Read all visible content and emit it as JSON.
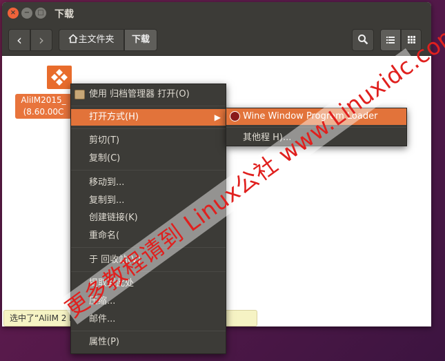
{
  "window": {
    "title": "下载",
    "controls": {
      "close": "×",
      "minimize": "−",
      "maximize": "□"
    }
  },
  "toolbar": {
    "back_icon": "‹",
    "forward_icon": "›",
    "breadcrumb": {
      "home_label": "主文件夹",
      "current_label": "下载"
    },
    "search_icon": "search-icon",
    "view_list_icon": "list-view-icon",
    "view_grid_icon": "grid-view-icon"
  },
  "files": [
    {
      "name_line1": "AliIM2015_",
      "name_line2": "(8.60.00C",
      "icon": "package-icon",
      "selected": true
    }
  ],
  "statusbar": {
    "text": "选中了“AliIM                                               2 MB)"
  },
  "context_menu": {
    "items": [
      {
        "label": "使用 归档管理器 打开(O)",
        "icon": "archive-manager-icon"
      },
      {
        "label": "打开方式(H)",
        "has_submenu": true,
        "active": true
      },
      {
        "label": "剪切(T)"
      },
      {
        "label": "复制(C)"
      },
      {
        "label": "移动到..."
      },
      {
        "label": "复制到..."
      },
      {
        "label": "创建链接(K)"
      },
      {
        "label": "重命名("
      },
      {
        "label": "于 回收站(V)"
      },
      {
        "label": "提取到此处"
      },
      {
        "label": "压缩..."
      },
      {
        "label": "邮件..."
      },
      {
        "label": "属性(P)"
      }
    ]
  },
  "submenu": {
    "items": [
      {
        "label": "Wine Window  Program Loader",
        "icon": "wine-icon",
        "active": true
      },
      {
        "label": "其他程  H)..."
      }
    ]
  },
  "watermark": {
    "text": "更多教程请到 Linux公社 www.Linuxidc.com"
  },
  "colors": {
    "accent": "#e2733a",
    "menu_bg": "#3c3b37",
    "desktop_bg": "#5a1a4c",
    "watermark": "#e0201e"
  }
}
